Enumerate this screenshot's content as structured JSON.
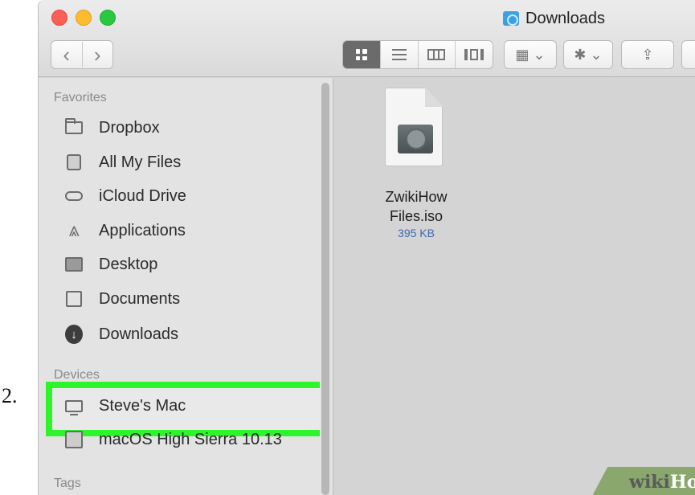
{
  "step": {
    "number": "2."
  },
  "window": {
    "title": "Downloads"
  },
  "toolbar": {
    "back_glyph": "‹",
    "forward_glyph": "›",
    "arrange_glyph": "▦ ⌄",
    "action_glyph": "✱ ⌄",
    "share_glyph": "⇪",
    "view_modes": [
      "icon-view",
      "list-view",
      "column-view",
      "coverflow-view"
    ],
    "active_view": "icon-view"
  },
  "sidebar": {
    "favorites_heading": "Favorites",
    "favorites": [
      {
        "label": "Dropbox",
        "icon": "folder-icon"
      },
      {
        "label": "All My Files",
        "icon": "all-files-icon"
      },
      {
        "label": "iCloud Drive",
        "icon": "cloud-icon"
      },
      {
        "label": "Applications",
        "icon": "applications-icon"
      },
      {
        "label": "Desktop",
        "icon": "desktop-icon"
      },
      {
        "label": "Documents",
        "icon": "documents-icon"
      },
      {
        "label": "Downloads",
        "icon": "download-icon"
      }
    ],
    "devices_heading": "Devices",
    "devices": [
      {
        "label": "Steve's Mac",
        "icon": "computer-icon"
      },
      {
        "label": "macOS High Sierra 10.13",
        "icon": "disk-image-icon"
      }
    ],
    "tags_heading": "Tags",
    "highlight_color": "#2ef52b"
  },
  "content": {
    "file": {
      "name_line1": "ZwikiHow",
      "name_line2": "Files.iso",
      "size": "395 KB"
    }
  },
  "watermark": {
    "part1": "wiki",
    "part2": "How"
  }
}
